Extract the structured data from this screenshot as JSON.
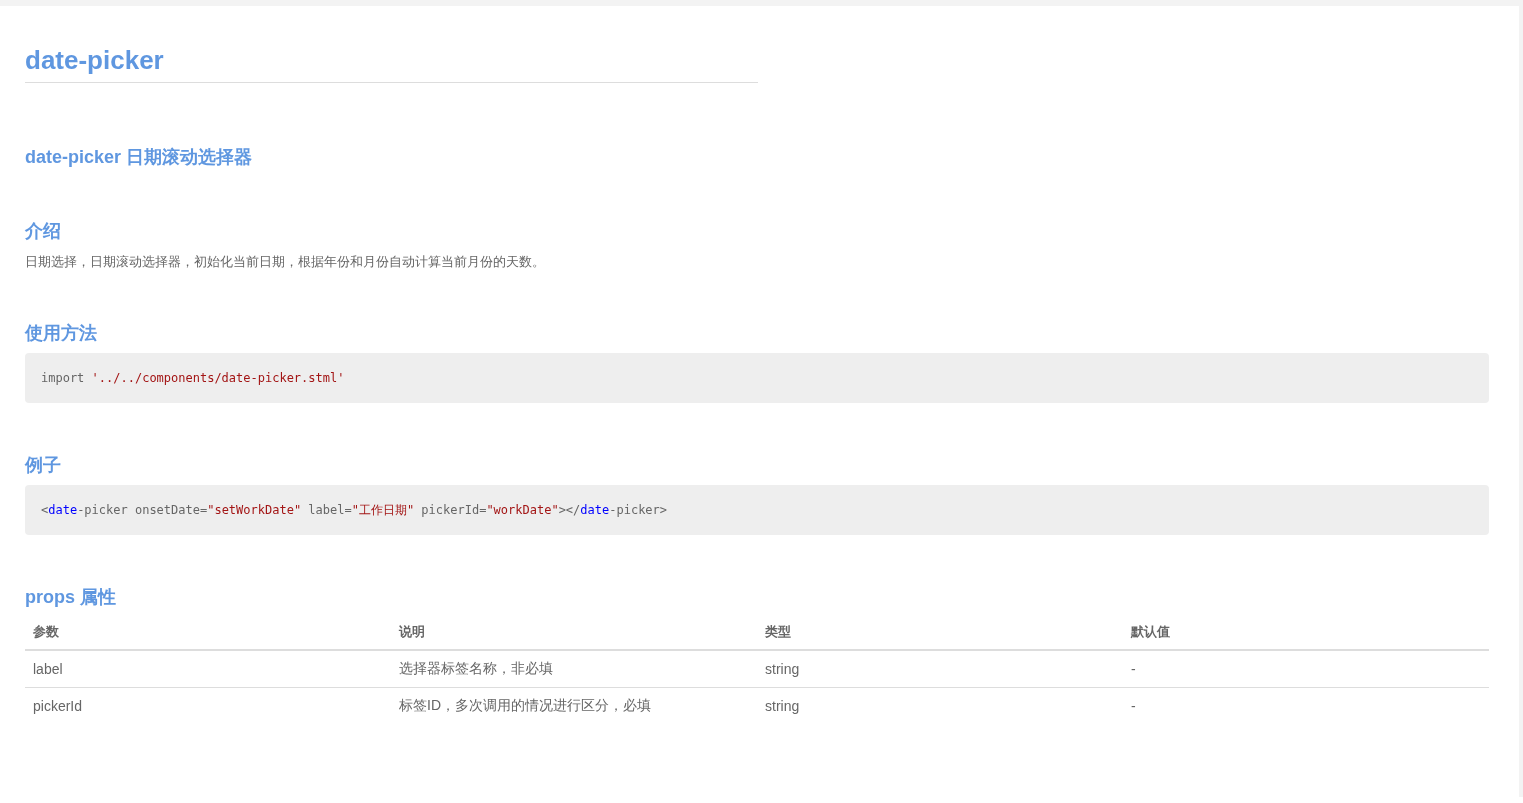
{
  "title": "date-picker",
  "subtitle": "date-picker 日期滚动选择器",
  "sections": [
    {
      "heading": "介绍",
      "paragraph": "日期选择，日期滚动选择器，初始化当前日期，根据年份和月份自动计算当前月份的天数。"
    },
    {
      "heading": "使用方法",
      "code": [
        {
          "kind": "plain",
          "text": "import "
        },
        {
          "kind": "string",
          "text": "'../../components/date-picker.stml'"
        }
      ]
    },
    {
      "heading": "例子",
      "code": [
        {
          "kind": "plain",
          "text": "<"
        },
        {
          "kind": "tag",
          "text": "date"
        },
        {
          "kind": "plain",
          "text": "-picker onsetDate="
        },
        {
          "kind": "string",
          "text": "\"setWorkDate\""
        },
        {
          "kind": "plain",
          "text": " label="
        },
        {
          "kind": "string",
          "text": "\"工作日期\""
        },
        {
          "kind": "plain",
          "text": " pickerId="
        },
        {
          "kind": "string",
          "text": "\"workDate\""
        },
        {
          "kind": "plain",
          "text": "></"
        },
        {
          "kind": "tag",
          "text": "date"
        },
        {
          "kind": "plain",
          "text": "-picker>"
        }
      ]
    }
  ],
  "props": {
    "heading": "props 属性",
    "table": {
      "columns": [
        "参数",
        "说明",
        "类型",
        "默认值"
      ],
      "rows": [
        [
          "label",
          "选择器标签名称，非必填",
          "string",
          "-"
        ],
        [
          "pickerId",
          "标签ID，多次调用的情况进行区分，必填",
          "string",
          "-"
        ]
      ]
    }
  }
}
